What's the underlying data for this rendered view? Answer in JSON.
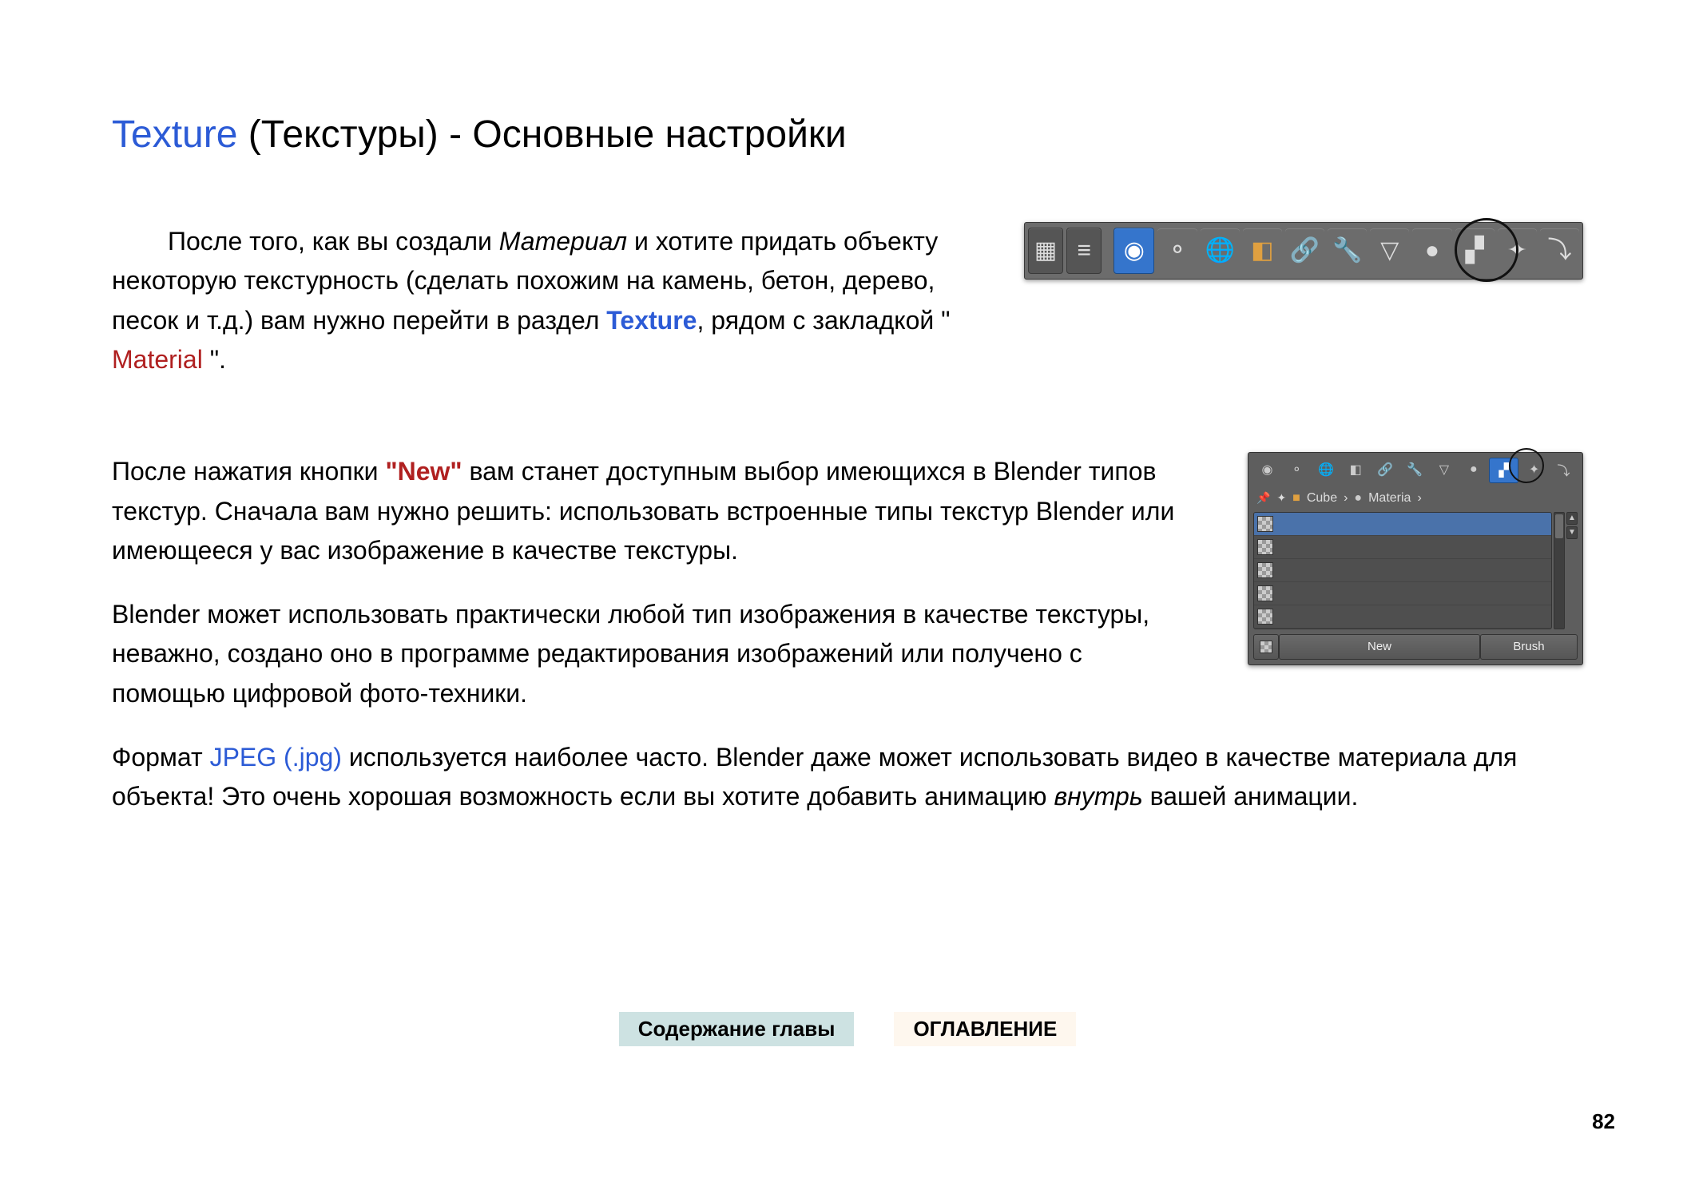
{
  "heading": {
    "title_link": "Texture",
    "title_rest": " (Текстуры) - Основные настройки"
  },
  "para1": {
    "t1": "После того, как вы создали ",
    "em1": "Материал",
    "t2": " и хотите придать объекту некоторую текстурность (сделать похожим на камень, бетон, дерево, песок и т.д.) вам нужно перейти в раздел ",
    "link1": "Texture",
    "t3": ", рядом с закладкой \" ",
    "link2": "Material",
    "t4": " \"."
  },
  "para2": {
    "t1": "После нажатия кнопки ",
    "strong1": "\"New\"",
    "t2": " вам станет доступным выбор имеющихся в Blender типов текстур. Сначала вам нужно решить: использовать встроенные типы текстур Blender или имеющееся у вас изображение в качестве текстуры."
  },
  "para3": "Blender может использовать практически любой тип изображения в качестве текстуры, неважно, создано оно в программе редактирования изображений или получено с помощью цифровой фото-техники.",
  "para4": {
    "t1": "Формат ",
    "link1": "JPEG (.jpg)",
    "t2": " используется наиболее часто. Blender даже может использовать видео в качестве материала для объекта! Это очень хорошая возможность если вы хотите добавить анимацию ",
    "em1": "внутрь",
    "t3": " вашей анимации."
  },
  "figure1": {
    "circled": "texture-tab"
  },
  "figure2": {
    "breadcrumb": {
      "item1": "Cube",
      "item2": "Materia"
    },
    "buttons": {
      "new": "New",
      "brush": "Brush"
    }
  },
  "footer": {
    "chapter_toc": "Содержание главы",
    "main_toc": "ОГЛАВЛЕНИЕ"
  },
  "page_number": "82"
}
